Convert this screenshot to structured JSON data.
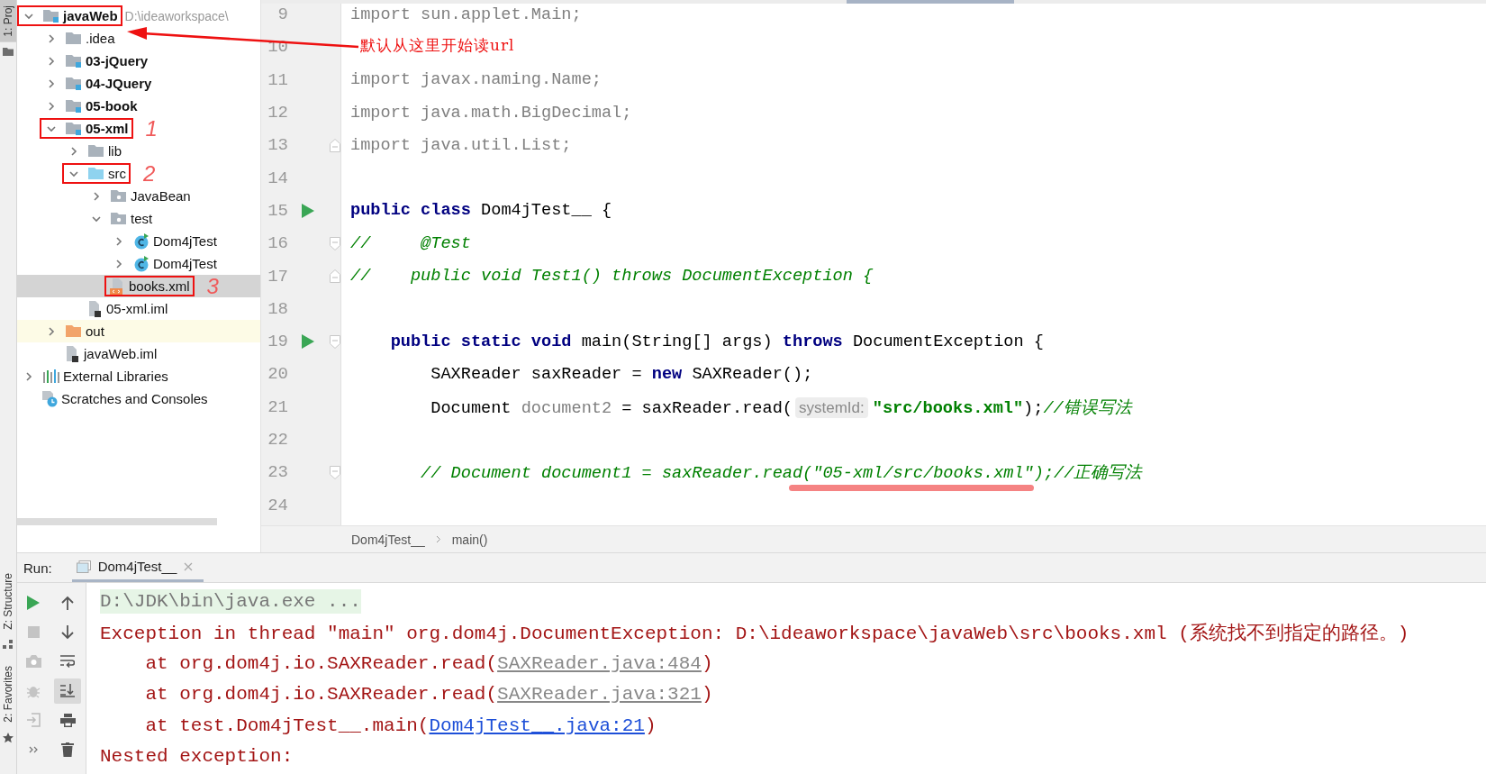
{
  "side_strip": {
    "top_tabs": [
      {
        "label": "1: Proj",
        "selected": true
      }
    ],
    "bottom_tabs": [
      {
        "label": "Z: Structure",
        "selected": false
      },
      {
        "label": "2: Favorites",
        "selected": false
      }
    ]
  },
  "project_tree": {
    "items": [
      {
        "label": "javaWeb",
        "path": "D:\\ideaworkspace\\",
        "kind": "module",
        "expanded": true,
        "selected": false,
        "boxed": true,
        "children": [
          {
            "label": ".idea",
            "kind": "folder",
            "expanded": false,
            "selected": false,
            "boxed": false
          },
          {
            "label": "03-jQuery",
            "kind": "module",
            "expanded": false,
            "selected": false,
            "boxed": false
          },
          {
            "label": "04-JQuery",
            "kind": "module",
            "expanded": false,
            "selected": false,
            "boxed": false
          },
          {
            "label": "05-book",
            "kind": "module",
            "expanded": false,
            "selected": false,
            "boxed": false
          },
          {
            "label": "05-xml",
            "kind": "module",
            "expanded": true,
            "selected": false,
            "boxed": true,
            "note": "1",
            "children": [
              {
                "label": "lib",
                "kind": "folder",
                "expanded": false,
                "selected": false,
                "boxed": false
              },
              {
                "label": "src",
                "kind": "source",
                "expanded": true,
                "selected": false,
                "boxed": true,
                "note": "2",
                "children": [
                  {
                    "label": "JavaBean",
                    "kind": "package",
                    "expanded": false,
                    "selected": false,
                    "boxed": false
                  },
                  {
                    "label": "test",
                    "kind": "package",
                    "expanded": true,
                    "selected": false,
                    "boxed": false,
                    "children": [
                      {
                        "label": "Dom4jTest",
                        "kind": "class",
                        "expanded": false,
                        "selected": false,
                        "boxed": false
                      },
                      {
                        "label": "Dom4jTest",
                        "kind": "class",
                        "expanded": false,
                        "selected": false,
                        "boxed": false
                      }
                    ]
                  },
                  {
                    "label": "books.xml",
                    "kind": "xml",
                    "selected": true,
                    "boxed": true,
                    "note": "3"
                  }
                ]
              },
              {
                "label": "05-xml.iml",
                "kind": "iml",
                "selected": false,
                "boxed": false
              }
            ]
          },
          {
            "label": "out",
            "kind": "excluded",
            "expanded": false,
            "selected": false,
            "boxed": false
          },
          {
            "label": "javaWeb.iml",
            "kind": "iml",
            "selected": false,
            "boxed": false
          }
        ]
      },
      {
        "label": "External Libraries",
        "kind": "libraries",
        "expanded": false,
        "selected": false,
        "boxed": false
      },
      {
        "label": "Scratches and Consoles",
        "kind": "scratches",
        "selected": false,
        "boxed": false
      }
    ]
  },
  "annotation": {
    "text": "默认从这里开始读url"
  },
  "editor": {
    "lines": [
      {
        "number": "9",
        "tokens": [
          {
            "kind": "unused",
            "text": "import sun.applet.Main;"
          }
        ]
      },
      {
        "number": "10"
      },
      {
        "number": "11",
        "tokens": [
          {
            "kind": "unused",
            "text": "import javax.naming.Name;"
          }
        ]
      },
      {
        "number": "12",
        "tokens": [
          {
            "kind": "unused",
            "text": "import java.math.BigDecimal;"
          }
        ]
      },
      {
        "number": "13",
        "fold": {
          "kind": "close"
        },
        "tokens": [
          {
            "kind": "unused",
            "text": "import java.util.List;"
          }
        ]
      },
      {
        "number": "14"
      },
      {
        "number": "15",
        "run": true,
        "tokens": [
          {
            "kind": "keyword",
            "text": "public class"
          },
          {
            "kind": "plain",
            "text": " Dom4jTest__ {"
          }
        ]
      },
      {
        "number": "16",
        "fold": {
          "kind": "open"
        },
        "tokens": [
          {
            "kind": "comment",
            "text": "//     @Test"
          }
        ]
      },
      {
        "number": "17",
        "fold": {
          "kind": "close"
        },
        "tokens": [
          {
            "kind": "comment",
            "text": "//    public void Test1() throws DocumentException {"
          }
        ]
      },
      {
        "number": "18"
      },
      {
        "number": "19",
        "run": true,
        "fold": {
          "kind": "open"
        },
        "tokens": [
          {
            "kind": "keyword",
            "text": "    public static void"
          },
          {
            "kind": "plain",
            "text": " main(String[] args) "
          },
          {
            "kind": "keyword",
            "text": "throws"
          },
          {
            "kind": "plain",
            "text": " DocumentException {"
          }
        ]
      },
      {
        "number": "20",
        "tokens": [
          {
            "kind": "plain",
            "text": "        SAXReader saxReader = "
          },
          {
            "kind": "keyword",
            "text": "new"
          },
          {
            "kind": "plain",
            "text": " SAXReader();"
          }
        ]
      },
      {
        "number": "21",
        "tokens": [
          {
            "kind": "plain",
            "text": "        Document "
          },
          {
            "kind": "unused",
            "text": "document2"
          },
          {
            "kind": "plain",
            "text": " = saxReader.read("
          },
          {
            "kind": "hint",
            "text": "systemId:"
          },
          {
            "kind": "string",
            "text": "\"src/books.xml\""
          },
          {
            "kind": "plain",
            "text": ");"
          },
          {
            "kind": "comment",
            "text": "//错误写法"
          }
        ]
      },
      {
        "number": "22"
      },
      {
        "number": "23",
        "fold": {
          "kind": "open"
        },
        "tokens": [
          {
            "kind": "comment",
            "text": "       // Document document1 = saxReader.read("
          },
          {
            "kind": "marked",
            "text": "\"05-xml/src/books.xml\""
          },
          {
            "kind": "comment",
            "text": ");//正确写法"
          }
        ]
      },
      {
        "number": "24"
      }
    ]
  },
  "breadcrumb": [
    "Dom4jTest__",
    "main()"
  ],
  "run_panel": {
    "label": "Run:",
    "tab": {
      "label": "Dom4jTest__",
      "selected": true
    },
    "left_tools": [
      {
        "kind": "run",
        "disabled": false
      },
      {
        "kind": "stop",
        "disabled": true
      },
      {
        "kind": "camera",
        "disabled": true
      },
      {
        "kind": "bug",
        "disabled": true
      },
      {
        "kind": "login",
        "disabled": true
      },
      {
        "kind": "more",
        "disabled": false
      }
    ],
    "right_tools": [
      {
        "kind": "up",
        "on": false
      },
      {
        "kind": "down",
        "on": false
      },
      {
        "kind": "wrap",
        "on": false
      },
      {
        "kind": "scroll-end",
        "on": true
      },
      {
        "kind": "print",
        "on": false
      },
      {
        "kind": "trash",
        "on": false
      }
    ],
    "console": [
      {
        "kind": "command",
        "tokens": [
          {
            "kind": "text",
            "text": "D:\\JDK\\bin\\java.exe ..."
          }
        ]
      },
      {
        "kind": "error",
        "tokens": [
          {
            "kind": "text",
            "text": "Exception in thread \"main\" org.dom4j.DocumentException: D:\\ideaworkspace\\javaWeb\\src\\books.xml (系统找不到指定的路径。)"
          }
        ]
      },
      {
        "kind": "error",
        "tokens": [
          {
            "kind": "text",
            "text": "    at org.dom4j.io.SAXReader.read("
          },
          {
            "kind": "link-muted",
            "text": "SAXReader.java:484"
          },
          {
            "kind": "text",
            "text": ")"
          }
        ]
      },
      {
        "kind": "error",
        "tokens": [
          {
            "kind": "text",
            "text": "    at org.dom4j.io.SAXReader.read("
          },
          {
            "kind": "link-muted",
            "text": "SAXReader.java:321"
          },
          {
            "kind": "text",
            "text": ")"
          }
        ]
      },
      {
        "kind": "error",
        "tokens": [
          {
            "kind": "text",
            "text": "    at test.Dom4jTest__.main("
          },
          {
            "kind": "link",
            "text": "Dom4jTest__.java:21"
          },
          {
            "kind": "text",
            "text": ")"
          }
        ]
      },
      {
        "kind": "error",
        "tokens": [
          {
            "kind": "text",
            "text": "Nested exception:"
          }
        ]
      }
    ]
  }
}
